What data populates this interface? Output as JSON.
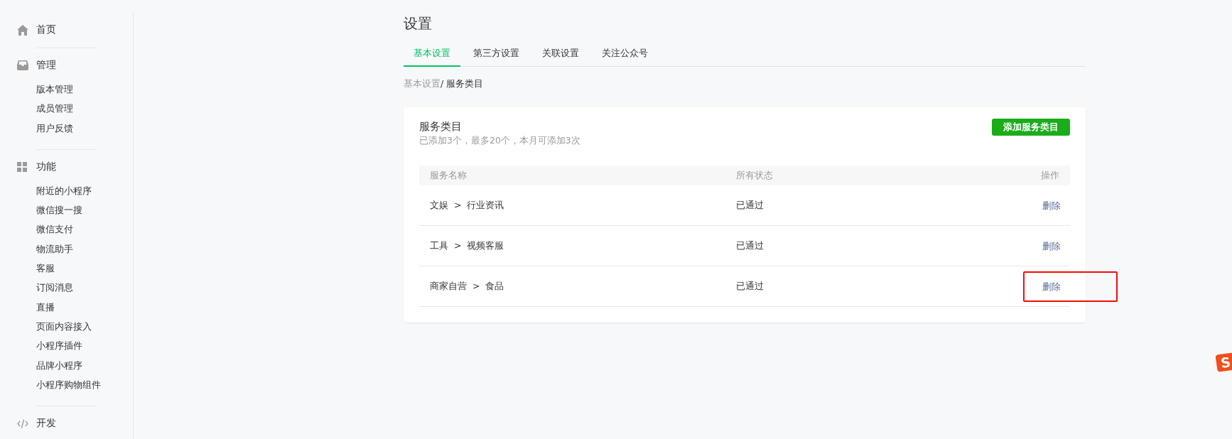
{
  "sidebar": {
    "sections": [
      {
        "label": "首页",
        "selected": false
      },
      {
        "label": "管理",
        "selected": false,
        "children": [
          {
            "label": "版本管理"
          },
          {
            "label": "成员管理"
          },
          {
            "label": "用户反馈"
          }
        ]
      },
      {
        "label": "功能",
        "selected": false,
        "children": [
          {
            "label": "附近的小程序"
          },
          {
            "label": "微信搜一搜"
          },
          {
            "label": "微信支付"
          },
          {
            "label": "物流助手"
          },
          {
            "label": "客服"
          },
          {
            "label": "订阅消息"
          },
          {
            "label": "直播"
          },
          {
            "label": "页面内容接入"
          },
          {
            "label": "小程序插件"
          },
          {
            "label": "品牌小程序"
          },
          {
            "label": "小程序购物组件"
          }
        ]
      },
      {
        "label": "开发",
        "selected": false
      }
    ]
  },
  "page": {
    "title": "设置",
    "tabs": [
      {
        "label": "基本设置",
        "selected": true
      },
      {
        "label": "第三方设置",
        "selected": false
      },
      {
        "label": "关联设置",
        "selected": false
      },
      {
        "label": "关注公众号",
        "selected": false
      }
    ],
    "breadcrumb": {
      "parent": "基本设置",
      "current": "/ 服务类目"
    },
    "card": {
      "title": "服务类目",
      "subtitle": "已添加3个，最多20个，本月可添加3次",
      "add_button": "添加服务类目",
      "table": {
        "columns": [
          "服务名称",
          "所有状态",
          "操作"
        ],
        "rows": [
          {
            "service": "文娱  >  行业资讯",
            "status": "已通过",
            "action": "删除",
            "highlighted": false
          },
          {
            "service": "工具  >  视频客服",
            "status": "已通过",
            "action": "删除",
            "highlighted": false
          },
          {
            "service": "商家自营  >  食品",
            "status": "已通过",
            "action": "删除",
            "highlighted": true
          }
        ]
      }
    }
  },
  "ime_badge": {
    "label": "S"
  }
}
